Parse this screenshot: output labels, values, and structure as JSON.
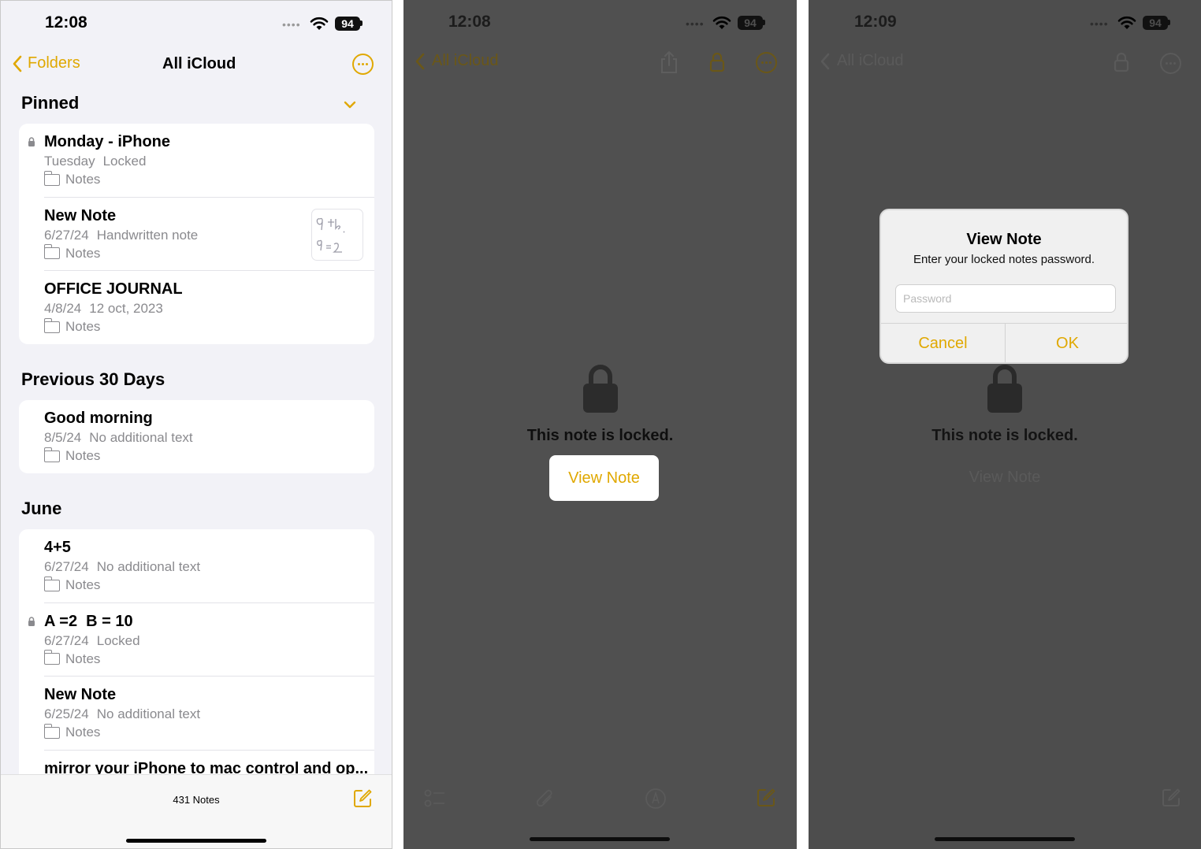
{
  "colors": {
    "accent": "#e0a800",
    "panel_bg": "#f2f2f7",
    "dim_bg": "#505050"
  },
  "phone1": {
    "status": {
      "time": "12:08",
      "battery": "94"
    },
    "nav": {
      "back_label": "Folders",
      "title": "All iCloud"
    },
    "sections": [
      {
        "title": "Pinned",
        "notes": [
          {
            "title": "Monday - iPhone",
            "date": "Tuesday",
            "preview": "Locked",
            "folder": "Notes",
            "locked": true
          },
          {
            "title": "New Note",
            "date": "6/27/24",
            "preview": "Handwritten note",
            "folder": "Notes"
          },
          {
            "title": "OFFICE JOURNAL",
            "date": "4/8/24",
            "preview": "12 oct, 2023",
            "folder": "Notes"
          }
        ]
      },
      {
        "title": "Previous 30 Days",
        "notes": [
          {
            "title": "Good morning",
            "date": "8/5/24",
            "preview": "No additional text",
            "folder": "Notes"
          }
        ]
      },
      {
        "title": "June",
        "notes": [
          {
            "title": "4+5",
            "date": "6/27/24",
            "preview": "No additional text",
            "folder": "Notes"
          },
          {
            "title": "A =2  B = 10",
            "date": "6/27/24",
            "preview": "Locked",
            "folder": "Notes",
            "locked": true
          },
          {
            "title": "New Note",
            "date": "6/25/24",
            "preview": "No additional text",
            "folder": "Notes"
          },
          {
            "title": "mirror your iPhone to mac control and op..."
          }
        ]
      }
    ],
    "notes_count": "431 Notes"
  },
  "phone2": {
    "status": {
      "time": "12:08",
      "battery": "94"
    },
    "nav": {
      "back_label": "All iCloud"
    },
    "locked_message": "This note is locked.",
    "view_note_label": "View Note"
  },
  "phone3": {
    "status": {
      "time": "12:09",
      "battery": "94"
    },
    "nav": {
      "back_label": "All iCloud"
    },
    "locked_message": "This note is locked.",
    "view_note_label": "View Note",
    "dialog": {
      "title": "View Note",
      "message": "Enter your locked notes password.",
      "placeholder": "Password",
      "cancel": "Cancel",
      "ok": "OK"
    }
  }
}
